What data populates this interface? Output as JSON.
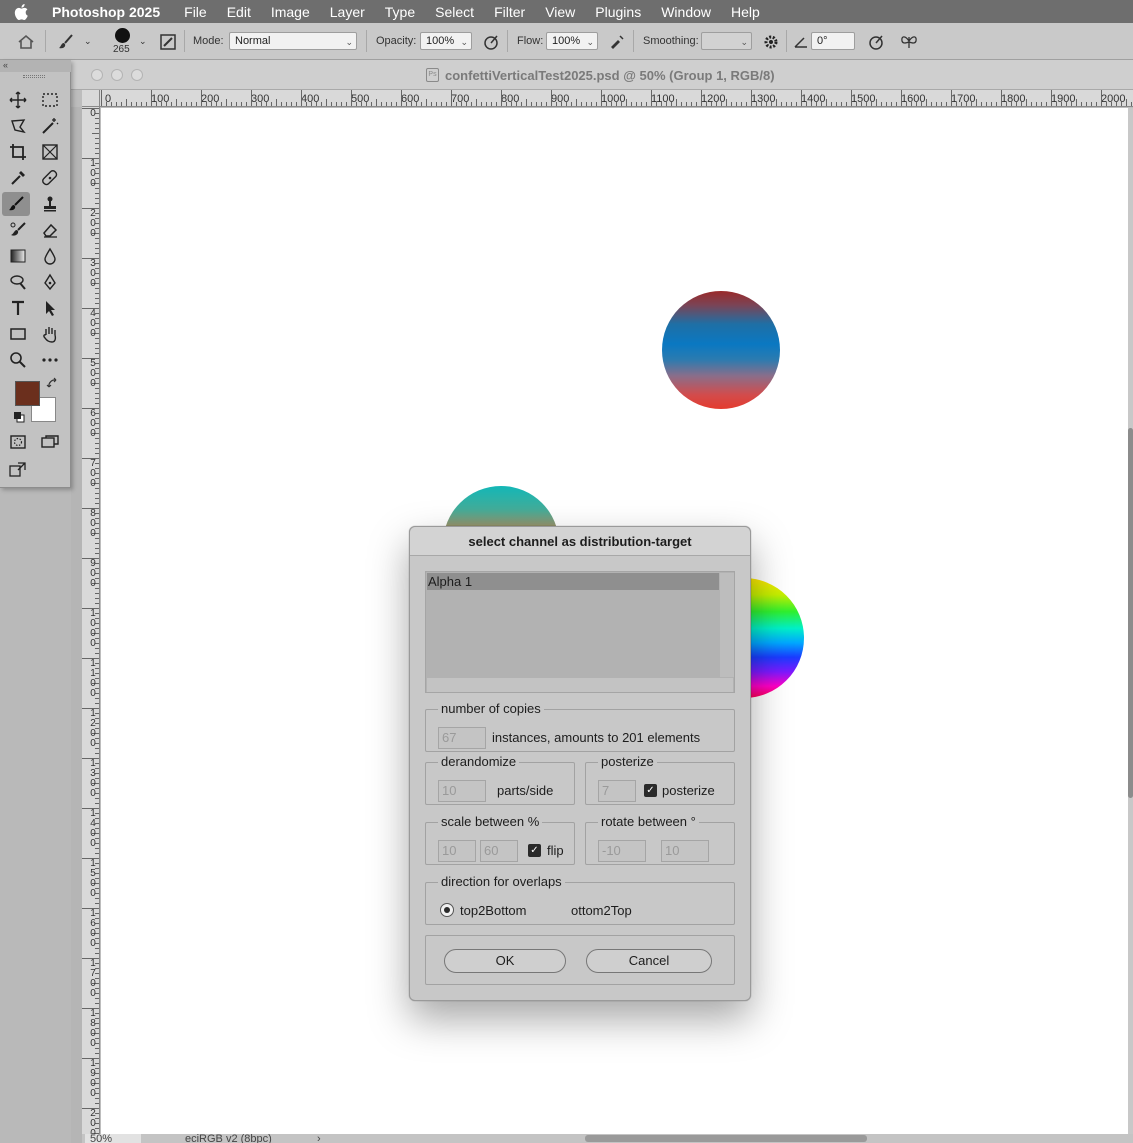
{
  "menubar": {
    "app_name": "Photoshop 2025",
    "items": [
      "File",
      "Edit",
      "Image",
      "Layer",
      "Type",
      "Select",
      "Filter",
      "View",
      "Plugins",
      "Window",
      "Help"
    ]
  },
  "options_bar": {
    "brush_size": "265",
    "mode_label": "Mode:",
    "mode_value": "Normal",
    "opacity_label": "Opacity:",
    "opacity_value": "100%",
    "flow_label": "Flow:",
    "flow_value": "100%",
    "smoothing_label": "Smoothing:",
    "smoothing_value": "",
    "angle_value": "0°"
  },
  "tool_panel": {
    "collapse_glyph": "«",
    "foreground_color": "#6b2f1d",
    "background_color": "#ffffff"
  },
  "document": {
    "title": "confettiVerticalTest2025.psd @ 50% (Group 1, RGB/8)",
    "ps_icon_text": "Ps",
    "ruler_h": [
      "0",
      "100",
      "200",
      "300",
      "400",
      "500",
      "600",
      "700",
      "800",
      "900",
      "1000",
      "1100",
      "1200",
      "1300",
      "1400",
      "1500",
      "1600",
      "1700",
      "1800",
      "1900",
      "2000"
    ],
    "ruler_v": [
      "0",
      "100",
      "200",
      "300",
      "400",
      "500",
      "600",
      "700",
      "800",
      "900",
      "1000",
      "1100",
      "1200",
      "1300",
      "1400",
      "1500",
      "1600",
      "1700",
      "1800",
      "1900",
      "2000"
    ],
    "zoom": "50%",
    "color_profile": "eciRGB v2 (8bpc)",
    "status_arrow": "›"
  },
  "dialog": {
    "title": "select channel as distribution-target",
    "channels": [
      "Alpha 1"
    ],
    "copies": {
      "label": "number of copies",
      "value": "67",
      "suffix": "instances, amounts to 201 elements"
    },
    "derandomize": {
      "label": "derandomize",
      "value": "10",
      "suffix": "parts/side"
    },
    "posterize": {
      "label": "posterize",
      "value": "7",
      "checkbox_label": "posterize",
      "checked": true
    },
    "scale": {
      "label": "scale between %",
      "min": "10",
      "max": "60",
      "flip_label": "flip",
      "flip_checked": true
    },
    "rotate": {
      "label": "rotate between °",
      "min": "-10",
      "max": "10"
    },
    "direction": {
      "label": "direction for overlaps",
      "option1": "top2Bottom",
      "option2": "ottom2Top",
      "selected": "top2Bottom"
    },
    "ok_label": "OK",
    "cancel_label": "Cancel"
  },
  "colors": {
    "menubar_bg": "#6e6e6e",
    "dialog_bg": "#c8c8c8",
    "selection_row": "#8f8f8f"
  }
}
